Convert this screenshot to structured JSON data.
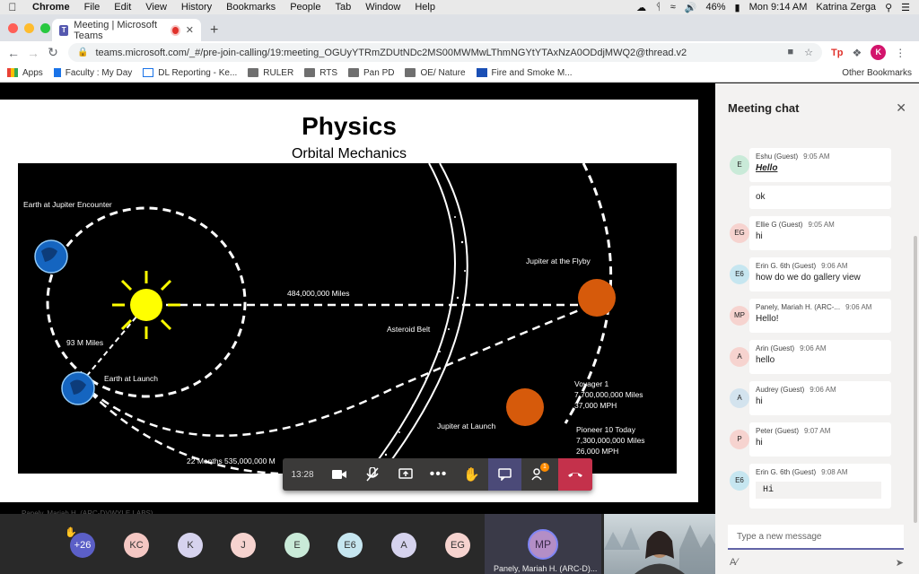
{
  "menubar": {
    "app": "Chrome",
    "items": [
      "File",
      "Edit",
      "View",
      "History",
      "Bookmarks",
      "People",
      "Tab",
      "Window",
      "Help"
    ],
    "battery": "46%",
    "clock": "Mon 9:14 AM",
    "user": "Katrina Zerga"
  },
  "browser": {
    "tab_title": "Meeting | Microsoft Teams",
    "url": "teams.microsoft.com/_#/pre-join-calling/19:meeting_OGUyYTRmZDUtNDc2MS00MWMwLThmNGYtYTAxNzA0ODdjMWQ2@thread.v2",
    "profile_initial": "K",
    "ext_label": "Tp"
  },
  "bookmarks": {
    "items": [
      "Apps",
      "Faculty : My Day",
      "DL Reporting - Ke...",
      "RULER",
      "RTS",
      "Pan PD",
      "OE/ Nature",
      "Fire and Smoke M..."
    ],
    "other": "Other Bookmarks"
  },
  "slide": {
    "title": "Physics",
    "subtitle": "Orbital Mechanics",
    "labels": {
      "earth_jupiter": "Earth at Jupiter Encounter",
      "distance_484": "484,000,000 Miles",
      "jupiter_flyby": "Jupiter at the Flyby",
      "m93": "93 M Miles",
      "asteroid_belt": "Asteroid Belt",
      "earth_launch": "Earth at Launch",
      "voyager_1": "Voyager 1",
      "voyager_miles": "7,700,000,000 Miles",
      "voyager_speed": "37,000 MPH",
      "jupiter_launch": "Jupiter at Launch",
      "pioneer": "Pioneer 10 Today",
      "pioneer_miles": "7,300,000,000 Miles",
      "pioneer_speed": "26,000 MPH",
      "months22": "22 Months 535,000,000 M"
    },
    "presenter": "Panely, Mariah H. (ARC-D)(WYLE LABS)"
  },
  "controls": {
    "timer": "13:28",
    "participants_badge": "1"
  },
  "participants": {
    "overflow": "+26",
    "avatars": [
      {
        "initials": "KC",
        "color": "#f4c7c3"
      },
      {
        "initials": "K",
        "color": "#d6d3ee"
      },
      {
        "initials": "J",
        "color": "#f6d3cf"
      },
      {
        "initials": "E",
        "color": "#c9ead8"
      },
      {
        "initials": "E6",
        "color": "#c6e6f0"
      },
      {
        "initials": "A",
        "color": "#d6d3ee"
      },
      {
        "initials": "EG",
        "color": "#f6d3cf"
      }
    ],
    "presenter_initials": "MP",
    "presenter_name": "Panely, Mariah H. (ARC-D)..."
  },
  "chat": {
    "title": "Meeting chat",
    "messages": [
      {
        "initials": "E",
        "author": "Eshu (Guest)",
        "time": "9:05 AM",
        "text": "Hello",
        "av_color": "#c9ead8"
      },
      {
        "initials": "",
        "author": "",
        "time": "",
        "text": "ok",
        "av_color": ""
      },
      {
        "initials": "EG",
        "author": "Ellie G (Guest)",
        "time": "9:05 AM",
        "text": "hi",
        "av_color": "#f6d3cf"
      },
      {
        "initials": "E6",
        "author": "Erin G. 6th (Guest)",
        "time": "9:06 AM",
        "text": "how do we do gallery view",
        "av_color": "#c6e6f0"
      },
      {
        "initials": "MP",
        "author": "Panely, Mariah H. (ARC-...",
        "time": "9:06 AM",
        "text": "Hello!",
        "av_color": "#f6d3cf"
      },
      {
        "initials": "A",
        "author": "Arin (Guest)",
        "time": "9:06 AM",
        "text": "hello",
        "av_color": "#f6d3cf"
      },
      {
        "initials": "A",
        "author": "Audrey (Guest)",
        "time": "9:06 AM",
        "text": "hi",
        "av_color": "#d3e3ee"
      },
      {
        "initials": "P",
        "author": "Peter (Guest)",
        "time": "9:07 AM",
        "text": "hi",
        "av_color": "#f6d3cf"
      },
      {
        "initials": "E6",
        "author": "Erin G. 6th (Guest)",
        "time": "9:08 AM",
        "text": "Hi",
        "av_color": "#c6e6f0"
      }
    ],
    "compose_placeholder": "Type a new message"
  }
}
